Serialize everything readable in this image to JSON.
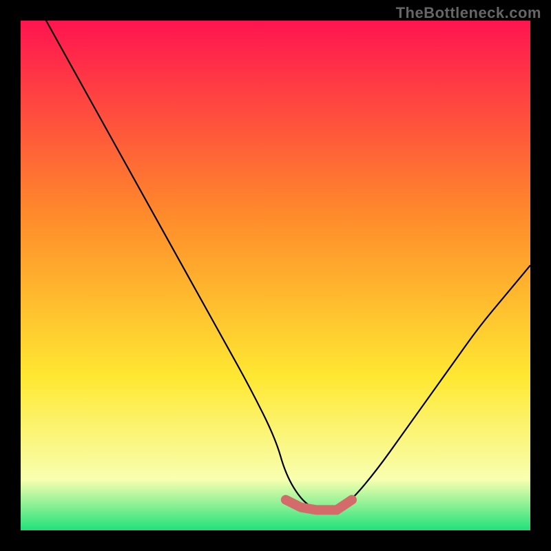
{
  "watermark": "TheBottleneck.com",
  "gradient": {
    "top": "#ff1450",
    "mid1": "#ff8a2b",
    "mid2": "#ffe832",
    "low": "#f8ffb0",
    "bottom": "#1fe27a",
    "stops": [
      0,
      0.38,
      0.7,
      0.9,
      1.0
    ]
  },
  "chart_data": {
    "type": "line",
    "title": "",
    "xlabel": "",
    "ylabel": "",
    "xlim": [
      0,
      100
    ],
    "ylim": [
      0,
      100
    ],
    "series": [
      {
        "name": "bottleneck-curve",
        "x": [
          5,
          10,
          15,
          20,
          25,
          30,
          35,
          40,
          45,
          50,
          52,
          55,
          58,
          60,
          62,
          65,
          70,
          75,
          80,
          85,
          90,
          95,
          100
        ],
        "y": [
          100,
          91,
          82,
          73,
          64,
          55,
          46,
          37,
          28,
          18,
          11,
          6,
          4,
          4,
          4,
          6,
          12,
          19,
          26,
          33,
          40,
          46,
          52
        ]
      },
      {
        "name": "optimal-range",
        "x": [
          52,
          55,
          58,
          60,
          62,
          65
        ],
        "y": [
          6,
          4.5,
          4,
          4,
          4,
          6
        ]
      }
    ],
    "optimal_x_range": [
      52,
      65
    ]
  }
}
